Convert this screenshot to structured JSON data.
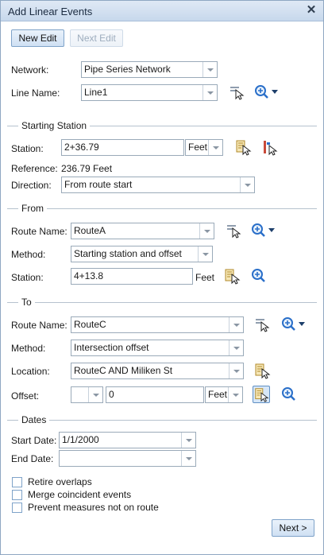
{
  "window": {
    "title": "Add Linear Events",
    "close_glyph": "✕"
  },
  "toolbar": {
    "new_edit": "New Edit",
    "next_edit": "Next Edit"
  },
  "network": {
    "label": "Network:",
    "value": "Pipe Series Network"
  },
  "line_name": {
    "label": "Line Name:",
    "value": "Line1"
  },
  "starting_station": {
    "title": "Starting Station",
    "station_label": "Station:",
    "station_value": "2+36.79",
    "units": "Feet",
    "reference_label": "Reference:",
    "reference_value": "236.79 Feet",
    "direction_label": "Direction:",
    "direction_value": "From route start"
  },
  "from": {
    "title": "From",
    "route_label": "Route Name:",
    "route_value": "RouteA",
    "method_label": "Method:",
    "method_value": "Starting station and offset",
    "station_label": "Station:",
    "station_value": "4+13.8",
    "station_units": "Feet"
  },
  "to": {
    "title": "To",
    "route_label": "Route Name:",
    "route_value": "RouteC",
    "method_label": "Method:",
    "method_value": "Intersection offset",
    "location_label": "Location:",
    "location_value": "RouteC AND Miliken St",
    "offset_label": "Offset:",
    "offset_sign": "",
    "offset_value": "0",
    "offset_units": "Feet"
  },
  "dates": {
    "title": "Dates",
    "start_label": "Start Date:",
    "start_value": "1/1/2000",
    "end_label": "End Date:",
    "end_value": ""
  },
  "options": [
    {
      "label": "Retire overlaps",
      "checked": false
    },
    {
      "label": "Merge coincident events",
      "checked": false
    },
    {
      "label": "Prevent measures not on route",
      "checked": false
    }
  ],
  "footer": {
    "next": "Next >"
  },
  "icons": [
    "close-icon",
    "select-line-icon",
    "zoom-in-icon",
    "select-station-icon",
    "flag-station-icon"
  ],
  "colors": {
    "titlebar": "#c7d8ec",
    "accent": "#2a6fc9",
    "border": "#9aaab9"
  }
}
